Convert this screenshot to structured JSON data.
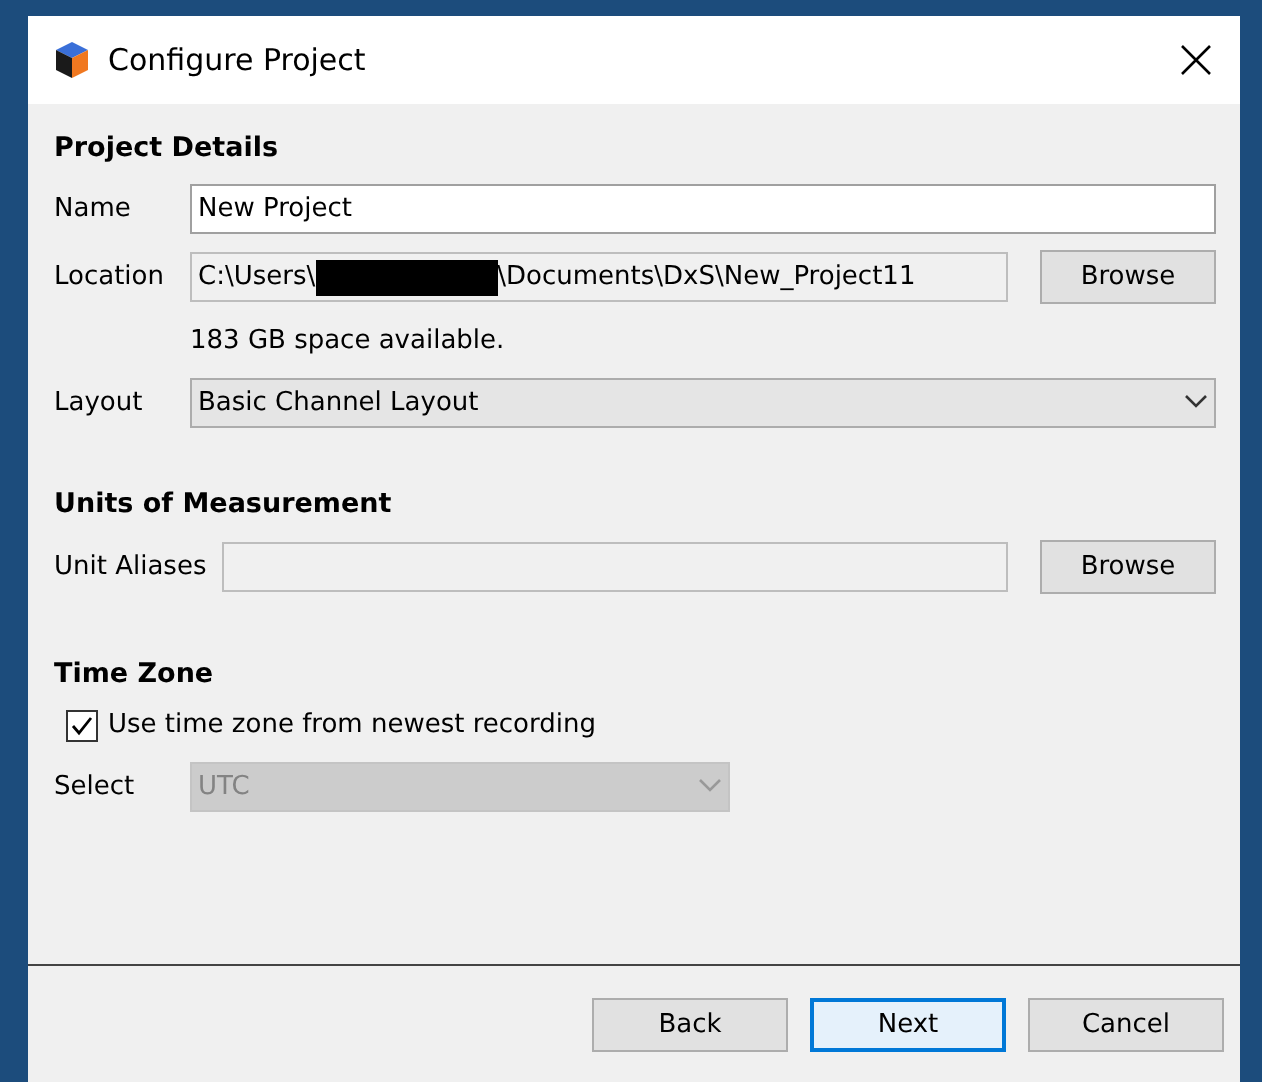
{
  "window": {
    "title": "Configure Project"
  },
  "project_details": {
    "heading": "Project Details",
    "name": {
      "label": "Name",
      "value": "New Project",
      "readonly": false
    },
    "location": {
      "label": "Location",
      "value_before": "C:\\Users\\",
      "redacted": true,
      "value_after": "\\Documents\\DxS\\New_Project11",
      "readonly": true,
      "button": "Browse"
    },
    "space_note": "183 GB space available.",
    "layout": {
      "label": "Layout",
      "value": "Basic Channel Layout",
      "disabled": false
    }
  },
  "units": {
    "heading": "Units of Measurement",
    "unit_aliases": {
      "label": "Unit Aliases",
      "readonly": true,
      "button": "Browse"
    }
  },
  "time_zone": {
    "heading": "Time Zone",
    "use_newest": {
      "label": "Use time zone from newest recording",
      "checked": true
    },
    "select": {
      "label": "Select",
      "value": "UTC",
      "disabled": true
    }
  },
  "buttons": [
    {
      "label": "Back",
      "focused": false
    },
    {
      "label": "Next",
      "focused": true
    },
    {
      "label": "Cancel",
      "focused": false
    }
  ]
}
